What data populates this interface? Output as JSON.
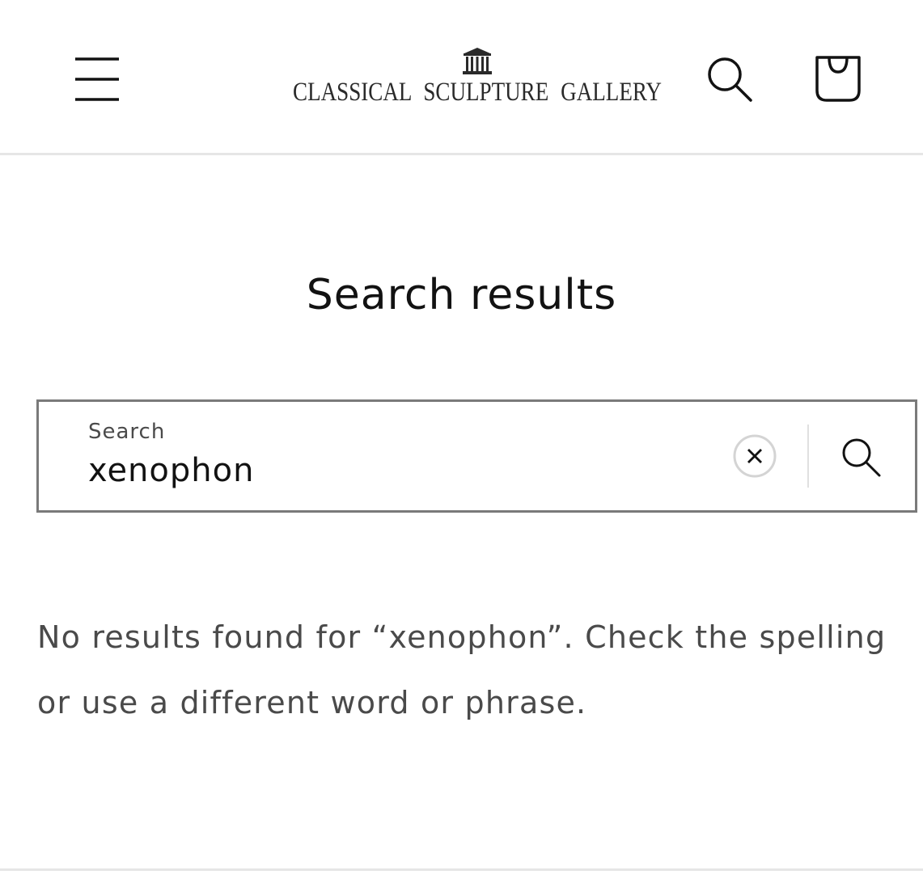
{
  "header": {
    "logo_text": "CLASSICAL SCULPTURE GALLERY",
    "menu_icon": "hamburger-menu-icon",
    "search_icon": "search-icon",
    "cart_icon": "shopping-bag-icon"
  },
  "main": {
    "title": "Search results",
    "search": {
      "label": "Search",
      "value": "xenophon",
      "clear_icon": "close-icon",
      "submit_icon": "search-icon"
    },
    "message": "No results found for “xenophon”. Check the spelling or use a different word or phrase."
  },
  "colors": {
    "text": "#121212",
    "muted_text": "#4a4a4a",
    "border": "#7a7a7a",
    "divider": "#e6e6e6"
  }
}
